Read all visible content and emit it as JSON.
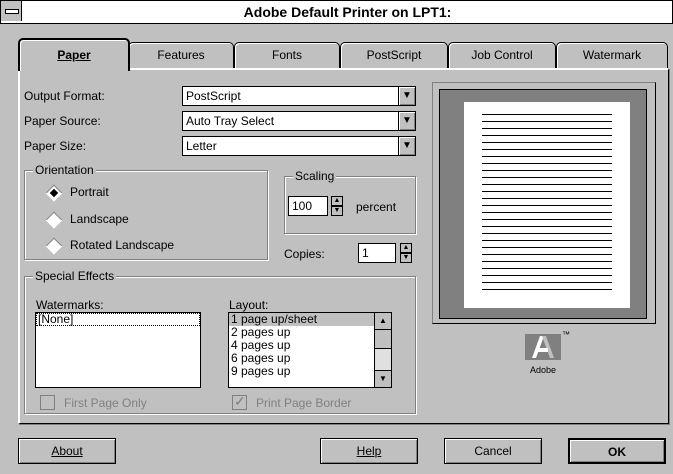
{
  "window": {
    "title": "Adobe Default Printer on LPT1:"
  },
  "tabs": [
    {
      "label": "Paper",
      "active": true
    },
    {
      "label": "Features"
    },
    {
      "label": "Fonts"
    },
    {
      "label": "PostScript"
    },
    {
      "label": "Job Control"
    },
    {
      "label": "Watermark"
    }
  ],
  "paper": {
    "output_format": {
      "label": "Output Format:",
      "value": "PostScript"
    },
    "paper_source": {
      "label": "Paper Source:",
      "value": "Auto Tray Select"
    },
    "paper_size": {
      "label": "Paper Size:",
      "value": "Letter"
    }
  },
  "orientation": {
    "title": "Orientation",
    "options": [
      "Portrait",
      "Landscape",
      "Rotated Landscape"
    ],
    "selected": "Portrait"
  },
  "scaling": {
    "title": "Scaling",
    "value": "100",
    "unit": "percent"
  },
  "copies": {
    "label": "Copies:",
    "value": "1"
  },
  "special_effects": {
    "title": "Special Effects",
    "watermarks_label": "Watermarks:",
    "watermarks": [
      "[None]"
    ],
    "layout_label": "Layout:",
    "layout_options": [
      "1 page up/sheet",
      "2 pages up",
      "4 pages up",
      "6 pages up",
      "9 pages up"
    ],
    "layout_selected": "1 page up/sheet",
    "first_page_only": {
      "label": "First Page Only",
      "checked": false
    },
    "print_page_border": {
      "label": "Print Page Border",
      "checked": true
    }
  },
  "logo": {
    "text": "Adobe",
    "tm": "™"
  },
  "buttons": {
    "about": "About",
    "help": "Help",
    "cancel": "Cancel",
    "ok": "OK"
  },
  "icons": {
    "dropdown": "dropdown-arrow-icon",
    "spin": "spin-arrows-icon",
    "system_menu": "system-menu-icon"
  }
}
